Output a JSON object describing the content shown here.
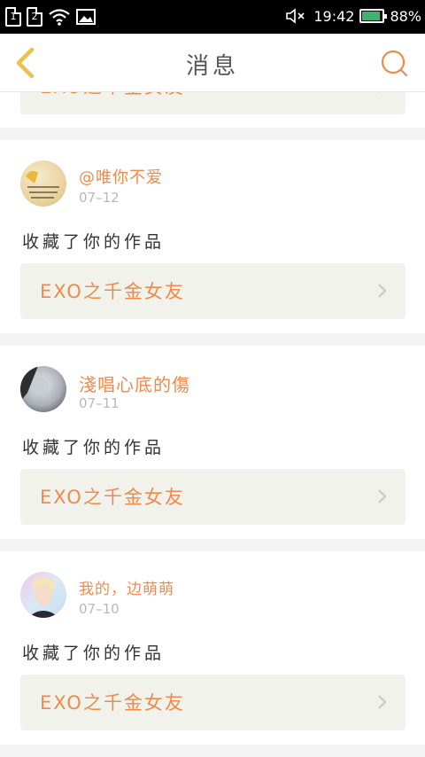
{
  "status_bar": {
    "sim1": "1",
    "sim2": "2",
    "time": "19:42",
    "battery": "88%",
    "battery_level": 0.88,
    "icons": [
      "sim-icon",
      "wifi-icon",
      "image-icon",
      "mute-icon",
      "battery-icon"
    ]
  },
  "nav": {
    "title": "消息",
    "back_icon": "chevron-left-icon",
    "search_icon": "search-icon"
  },
  "partial_card": {
    "work_title": "EXO之千金女友"
  },
  "messages": [
    {
      "username": "@唯你不爱",
      "date": "07–12",
      "action": "收藏了你的作品",
      "work_title": "EXO之千金女友"
    },
    {
      "username": "淺唱心底的傷",
      "date": "07–11",
      "action": "收藏了你的作品",
      "work_title": "EXO之千金女友"
    },
    {
      "username": "我的，边萌萌",
      "date": "07–10",
      "action": "收藏了你的作品",
      "work_title": "EXO之千金女友"
    }
  ],
  "colors": {
    "accent": "#f08a4b",
    "back_icon": "#e8c24a",
    "divider": "#f3f3f3",
    "work_box": "#f2f2ec"
  }
}
